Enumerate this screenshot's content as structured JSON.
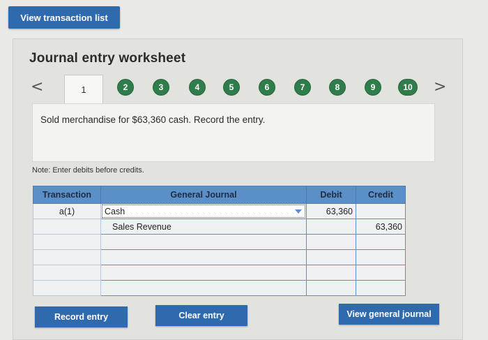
{
  "top": {
    "view_transactions_label": "View transaction list"
  },
  "worksheet": {
    "title": "Journal entry worksheet",
    "prev_label": "<",
    "next_label": ">",
    "tabs": [
      "1",
      "2",
      "3",
      "4",
      "5",
      "6",
      "7",
      "8",
      "9",
      "10"
    ],
    "description": "Sold merchandise for $63,360 cash. Record the entry.",
    "note": "Note: Enter debits before credits."
  },
  "journal": {
    "headers": {
      "transaction": "Transaction",
      "general_journal": "General Journal",
      "debit": "Debit",
      "credit": "Credit"
    },
    "rows": [
      {
        "transaction": "a(1)",
        "account": "Cash",
        "debit": "63,360",
        "credit": ""
      },
      {
        "transaction": "",
        "account": "Sales Revenue",
        "debit": "",
        "credit": "63,360"
      },
      {
        "transaction": "",
        "account": "",
        "debit": "",
        "credit": ""
      },
      {
        "transaction": "",
        "account": "",
        "debit": "",
        "credit": ""
      },
      {
        "transaction": "",
        "account": "",
        "debit": "",
        "credit": ""
      },
      {
        "transaction": "",
        "account": "",
        "debit": "",
        "credit": ""
      }
    ]
  },
  "buttons": {
    "record_entry": "Record entry",
    "clear_entry": "Clear entry",
    "view_general_journal": "View general journal"
  },
  "colors": {
    "primary": "#2e6aad",
    "step_green": "#2f7d4b",
    "header_blue": "#5b8fc7"
  }
}
